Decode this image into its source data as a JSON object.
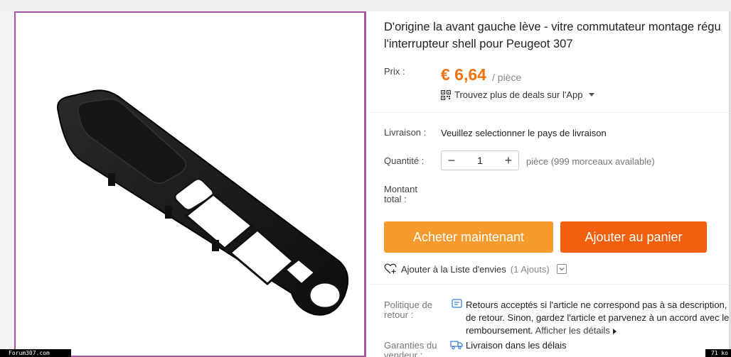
{
  "product": {
    "title_line1": "D'origine la avant gauche lève - vitre commutateur montage régu",
    "title_line2": "l'interrupteur shell pour Peugeot 307"
  },
  "price": {
    "label": "Prix :",
    "value": "€ 6,64",
    "unit": "/ pièce",
    "app_deal": "Trouvez plus de deals sur l'App"
  },
  "shipping": {
    "label": "Livraison :",
    "value": "Veuillez selectionner le pays de livraison"
  },
  "quantity": {
    "label": "Quantité :",
    "minus": "−",
    "value": "1",
    "plus": "+",
    "note": "pièce (999 morceaux available)"
  },
  "total": {
    "label_line1": "Montant",
    "label_line2": "total :"
  },
  "buttons": {
    "buy": "Acheter maintenant",
    "cart": "Ajouter au panier"
  },
  "wishlist": {
    "label": "Ajouter à la Liste d'envies",
    "count": "(1 Ajouts)"
  },
  "policy": {
    "label_line1": "Politique de",
    "label_line2": "retour :",
    "line1": "Retours acceptés si l'article ne correspond pas à sa description,",
    "line2": "de retour. Sinon, gardez l'article et parvenez à un accord avec le",
    "line3": "remboursement.",
    "more_link": "Afficher les détails"
  },
  "warranty": {
    "label_line1": "Garanties du",
    "label_line2": "vendeur :",
    "value": "Livraison dans les délais"
  },
  "overlay": {
    "site": "Forum307.com",
    "size": "71 ko"
  },
  "colors": {
    "price": "#f0720e",
    "buy_button": "#f59b2d",
    "cart_button": "#f2600d",
    "image_border": "#a855a8"
  },
  "icons": [
    "qr-code-icon",
    "heart-plus-icon",
    "chevron-down-icon",
    "return-policy-icon",
    "truck-icon"
  ]
}
